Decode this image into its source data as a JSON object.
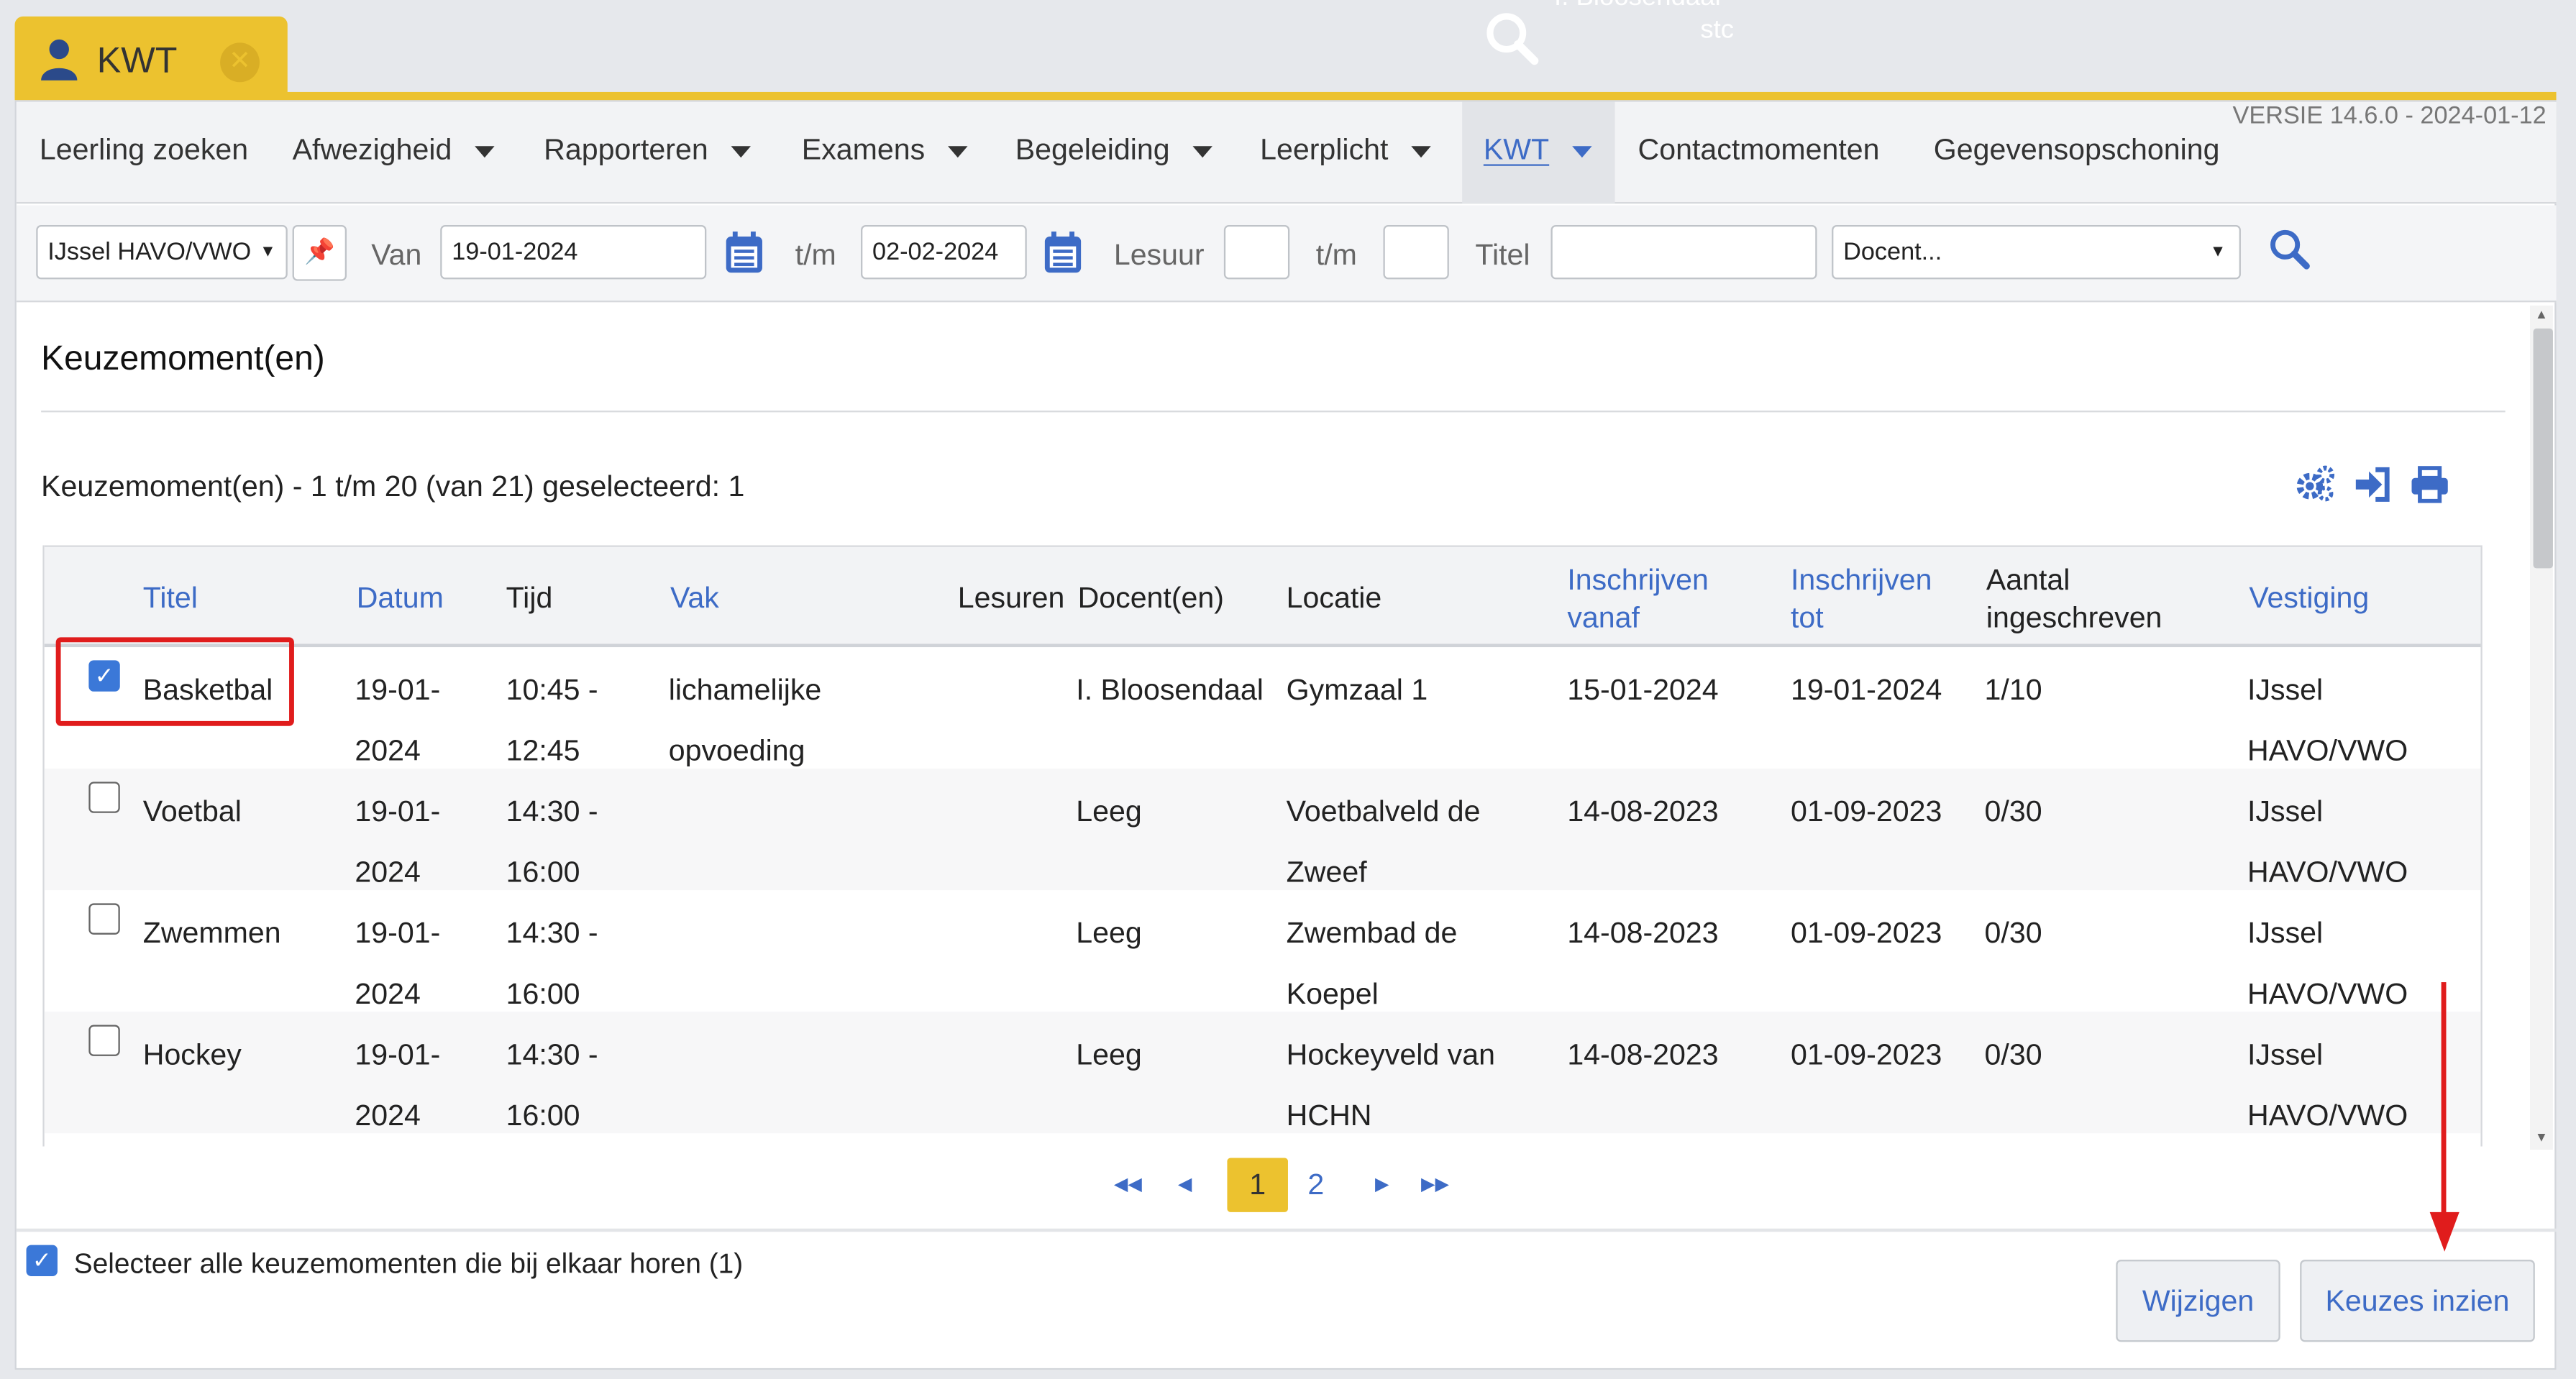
{
  "tab": {
    "label": "KWT",
    "icon": "user-icon",
    "close_icon": "close-icon"
  },
  "ghost_text": [
    "I. Bloosendaal",
    "stc"
  ],
  "menu": {
    "items": [
      {
        "label": "Leerling zoeken",
        "dropdown": false
      },
      {
        "label": "Afwezigheid",
        "dropdown": true
      },
      {
        "label": "Rapporteren",
        "dropdown": true
      },
      {
        "label": "Examens",
        "dropdown": true
      },
      {
        "label": "Begeleiding",
        "dropdown": true
      },
      {
        "label": "Leerplicht",
        "dropdown": true
      },
      {
        "label": "KWT",
        "dropdown": true,
        "active": true
      },
      {
        "label": "Contactmomenten",
        "dropdown": false
      },
      {
        "label": "Gegevensopschoning",
        "dropdown": false
      }
    ],
    "version": "VERSIE 14.6.0 - 2024-01-12"
  },
  "filters": {
    "location": "IJssel HAVO/VWO",
    "van_label": "Van",
    "van_value": "19-01-2024",
    "tm_label": "t/m",
    "tm_value": "02-02-2024",
    "lesuur_label": "Lesuur",
    "lesuur_from": "",
    "lesuur_tm_label": "t/m",
    "lesuur_to": "",
    "titel_label": "Titel",
    "titel_value": "",
    "docent_value": "Docent..."
  },
  "content": {
    "title": "Keuzemoment(en)",
    "subtitle": "Keuzemoment(en) - 1 t/m 20 (van 21) geselecteerd: 1",
    "toolbar_icons": [
      "settings-gears-icon",
      "import-icon",
      "print-icon"
    ]
  },
  "table": {
    "headers": {
      "titel": "Titel",
      "datum": "Datum",
      "tijd": "Tijd",
      "vak": "Vak",
      "lesuren": "Lesuren",
      "docenten": "Docent(en)",
      "locatie": "Locatie",
      "inschrijven_vanaf_1": "Inschrijven",
      "inschrijven_vanaf_2": "vanaf",
      "inschrijven_tot_1": "Inschrijven",
      "inschrijven_tot_2": "tot",
      "aantal_1": "Aantal",
      "aantal_2": "ingeschreven",
      "vestiging": "Vestiging"
    },
    "rows": [
      {
        "checked": true,
        "titel": "Basketbal",
        "datum_1": "19-01-",
        "datum_2": "2024",
        "tijd_1": "10:45 -",
        "tijd_2": "12:45",
        "vak_1": "lichamelijke",
        "vak_2": "opvoeding",
        "lesuren": "",
        "docent": "I. Bloosendaal",
        "locatie_1": "Gymzaal 1",
        "locatie_2": "",
        "vanaf": "15-01-2024",
        "tot": "19-01-2024",
        "aantal": "1/10",
        "vestiging_1": "IJssel",
        "vestiging_2": "HAVO/VWO"
      },
      {
        "checked": false,
        "titel": "Voetbal",
        "datum_1": "19-01-",
        "datum_2": "2024",
        "tijd_1": "14:30 -",
        "tijd_2": "16:00",
        "vak_1": "",
        "vak_2": "",
        "lesuren": "",
        "docent": "Leeg",
        "locatie_1": "Voetbalveld de",
        "locatie_2": "Zweef",
        "vanaf": "14-08-2023",
        "tot": "01-09-2023",
        "aantal": "0/30",
        "vestiging_1": "IJssel",
        "vestiging_2": "HAVO/VWO"
      },
      {
        "checked": false,
        "titel": "Zwemmen",
        "datum_1": "19-01-",
        "datum_2": "2024",
        "tijd_1": "14:30 -",
        "tijd_2": "16:00",
        "vak_1": "",
        "vak_2": "",
        "lesuren": "",
        "docent": "Leeg",
        "locatie_1": "Zwembad de",
        "locatie_2": "Koepel",
        "vanaf": "14-08-2023",
        "tot": "01-09-2023",
        "aantal": "0/30",
        "vestiging_1": "IJssel",
        "vestiging_2": "HAVO/VWO"
      },
      {
        "checked": false,
        "titel": "Hockey",
        "datum_1": "19-01-",
        "datum_2": "2024",
        "tijd_1": "14:30 -",
        "tijd_2": "16:00",
        "vak_1": "",
        "vak_2": "",
        "lesuren": "",
        "docent": "Leeg",
        "locatie_1": "Hockeyveld van",
        "locatie_2": "HCHN",
        "vanaf": "14-08-2023",
        "tot": "01-09-2023",
        "aantal": "0/30",
        "vestiging_1": "IJssel",
        "vestiging_2": "HAVO/VWO"
      }
    ]
  },
  "pager": {
    "first": "◂◂",
    "prev": "◂",
    "current": "1",
    "page2": "2",
    "next": "▸",
    "last": "▸▸"
  },
  "footer": {
    "select_all_label": "Selecteer alle keuzemomenten die bij elkaar horen (1)",
    "select_all_checked": true,
    "btn_wijzigen": "Wijzigen",
    "btn_keuzes": "Keuzes inzien"
  },
  "colors": {
    "accent": "#ecc22f",
    "link": "#3d6bc6",
    "annotation": "#e01c1c"
  }
}
